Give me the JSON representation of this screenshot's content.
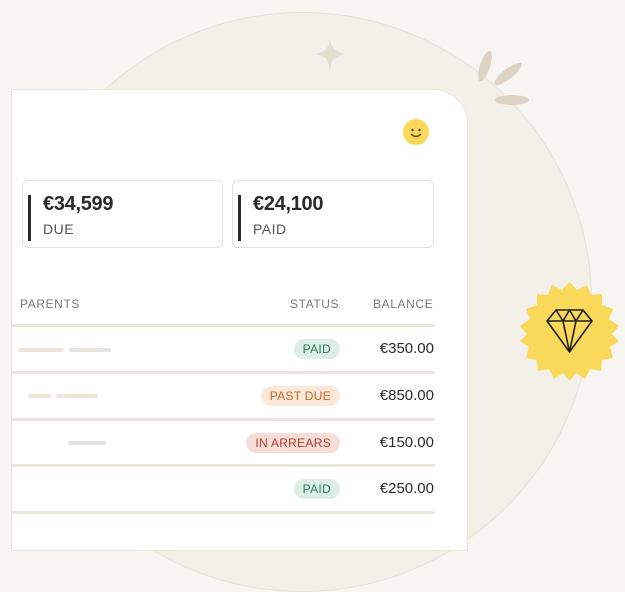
{
  "summary": {
    "due": {
      "amount": "€34,599",
      "label": "DUE"
    },
    "paid": {
      "amount": "€24,100",
      "label": "PAID"
    }
  },
  "table": {
    "headers": {
      "parents": "PARENTS",
      "status": "STATUS",
      "balance": "BALANCE"
    },
    "rows": [
      {
        "status": "PAID",
        "status_kind": "paid",
        "balance": "€350.00"
      },
      {
        "status": "PAST DUE",
        "status_kind": "pastdue",
        "balance": "€850.00"
      },
      {
        "status": "IN ARREARS",
        "status_kind": "arrears",
        "balance": "€150.00"
      },
      {
        "status": "PAID",
        "status_kind": "paid",
        "balance": "€250.00"
      }
    ]
  },
  "colors": {
    "accent_yellow": "#f9d85a",
    "paid_green": "#2f7a57",
    "past_due_orange": "#c9652a",
    "arrears_red": "#b43d2c"
  },
  "icons": [
    "sparkle-icon",
    "rays-icon",
    "smiley-icon",
    "diamond-icon"
  ]
}
